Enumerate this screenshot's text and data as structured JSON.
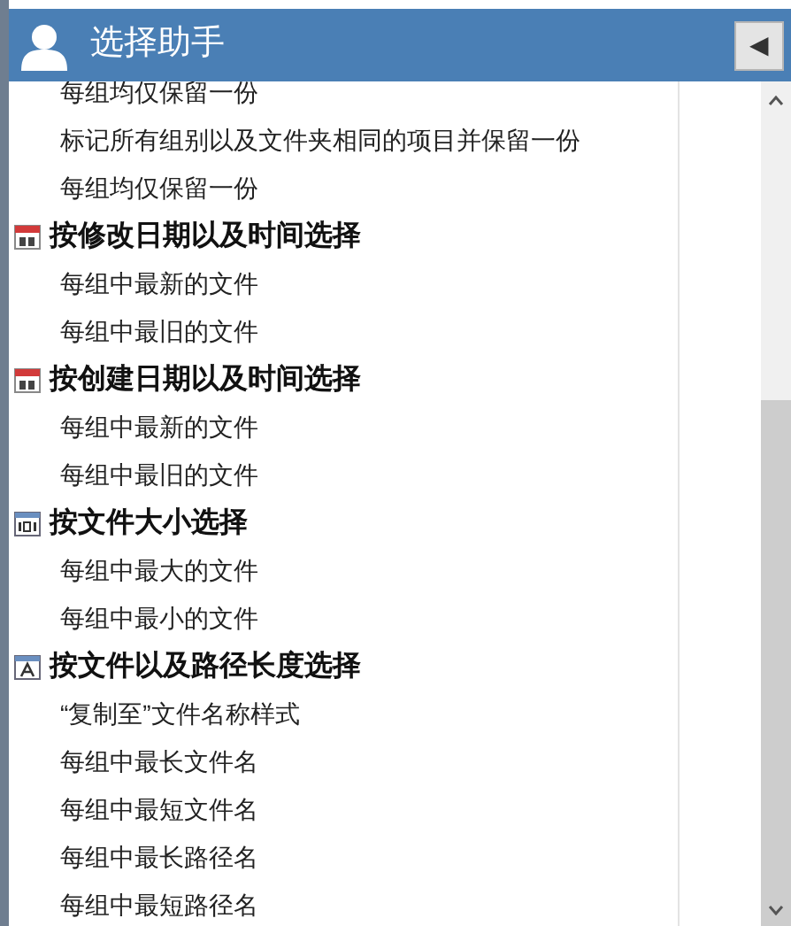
{
  "panel": {
    "title": "选择助手",
    "collapse_glyph": "◀"
  },
  "groups": [
    {
      "items": [
        "每组均仅保留一份",
        "标记所有组别以及文件夹相同的项目并保留一份",
        "每组均仅保留一份"
      ]
    },
    {
      "kind": "date",
      "title": "按修改日期以及时间选择",
      "items": [
        "每组中最新的文件",
        "每组中最旧的文件"
      ]
    },
    {
      "kind": "date",
      "title": "按创建日期以及时间选择",
      "items": [
        "每组中最新的文件",
        "每组中最旧的文件"
      ]
    },
    {
      "kind": "size",
      "title": "按文件大小选择",
      "items": [
        "每组中最大的文件",
        "每组中最小的文件"
      ]
    },
    {
      "kind": "text",
      "title": "按文件以及路径长度选择",
      "items": [
        "“复制至”文件名称样式",
        "每组中最长文件名",
        "每组中最短文件名",
        "每组中最长路径名",
        "每组中最短路径名"
      ]
    }
  ]
}
